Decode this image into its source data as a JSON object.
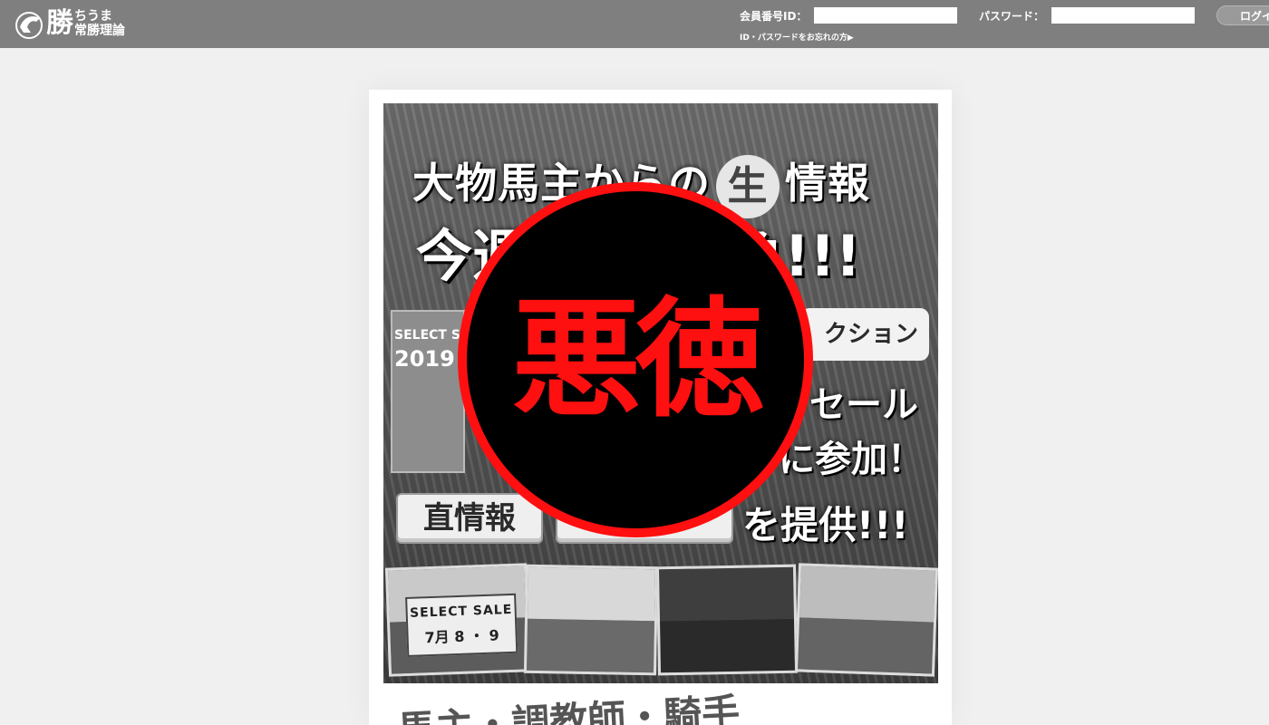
{
  "header": {
    "logo_kanji": "勝",
    "logo_sub_1": "ちうま",
    "logo_sub_2": "常勝理論",
    "member_id_label": "会員番号ID：",
    "password_label": "パスワード：",
    "forgot_link": "ID・パスワードをお忘れの方▶",
    "login_button": "ログイン"
  },
  "banner": {
    "headline_1_pre": "大物馬主からの",
    "headline_1_circle": "生",
    "headline_1_post": "情報",
    "headline_2": "今週",
    "headline_2_end": "負!!!",
    "photo_left_text": "SELECT SALE",
    "photo_left_year": "2019",
    "pill_right": "クション",
    "right_line_1": "セール",
    "right_line_2": "に参加！",
    "box_1": "直情報",
    "box_2": "",
    "teikyo": "を提供!!!",
    "sale_sign_title": "SELECT SALE",
    "sale_sign_date": "7月 8 ・ 9"
  },
  "seal": {
    "text": "悪徳",
    "border_color": "#ff0f0f",
    "text_color": "#ff1010"
  },
  "bottom": {
    "title": "馬主・調教師・騎手"
  }
}
